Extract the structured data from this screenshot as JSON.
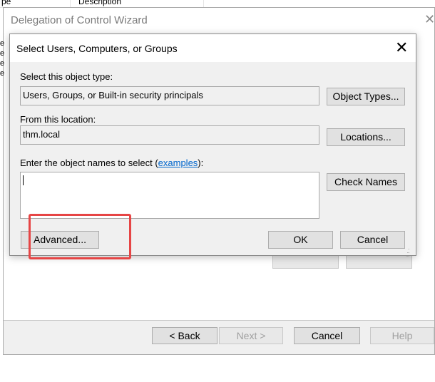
{
  "background": {
    "column1": "pe",
    "column2": "Description",
    "left_letters": [
      "e",
      "e",
      "e",
      "e"
    ]
  },
  "wizard": {
    "title": "Delegation of Control Wizard",
    "close_glyph": "✕",
    "buttons": {
      "back": "< Back",
      "next": "Next >",
      "cancel": "Cancel",
      "help": "Help"
    }
  },
  "dialog": {
    "title": "Select Users, Computers, or Groups",
    "close_glyph": "✕",
    "object_type_label": "Select this object type:",
    "object_type_value": "Users, Groups, or Built-in security principals",
    "object_types_button": "Object Types...",
    "location_label": "From this location:",
    "location_value": "thm.local",
    "locations_button": "Locations...",
    "names_label_prefix": "Enter the object names to select (",
    "names_label_link": "examples",
    "names_label_suffix": "):",
    "names_value": "",
    "check_names_button": "Check Names",
    "advanced_button": "Advanced...",
    "ok_button": "OK",
    "cancel_button": "Cancel"
  },
  "colors": {
    "highlight": "#e64545",
    "link": "#0066cc"
  }
}
